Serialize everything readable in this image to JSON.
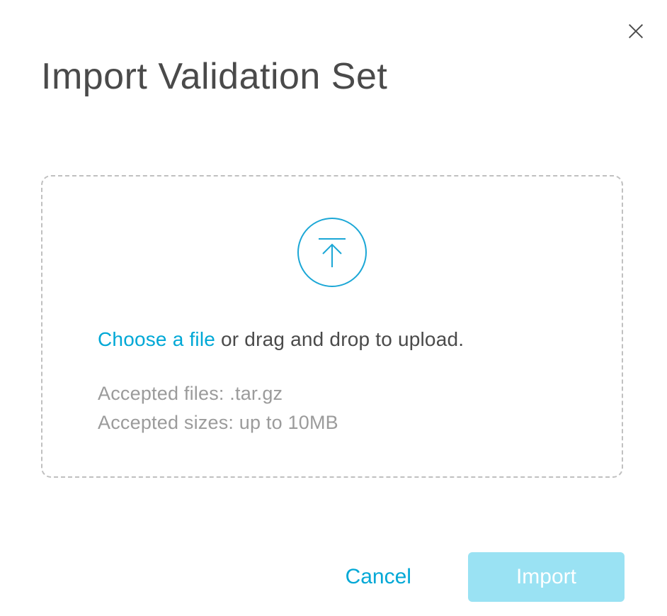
{
  "dialog": {
    "title": "Import Validation Set"
  },
  "dropzone": {
    "choose_file_label": "Choose a file",
    "drag_drop_suffix": " or drag and drop to upload.",
    "accepted_files_line": "Accepted files: .tar.gz",
    "accepted_sizes_line": "Accepted sizes: up to 10MB"
  },
  "buttons": {
    "cancel_label": "Cancel",
    "import_label": "Import"
  },
  "icons": {
    "close": "close-icon",
    "upload": "upload-icon"
  },
  "colors": {
    "accent": "#00a8d6",
    "title_text": "#4a4a4a",
    "muted_text": "#9b9b9b",
    "import_bg": "#9ae2f3",
    "border_dash": "#c0c0c0",
    "icon_ring": "#1ba7d6"
  }
}
